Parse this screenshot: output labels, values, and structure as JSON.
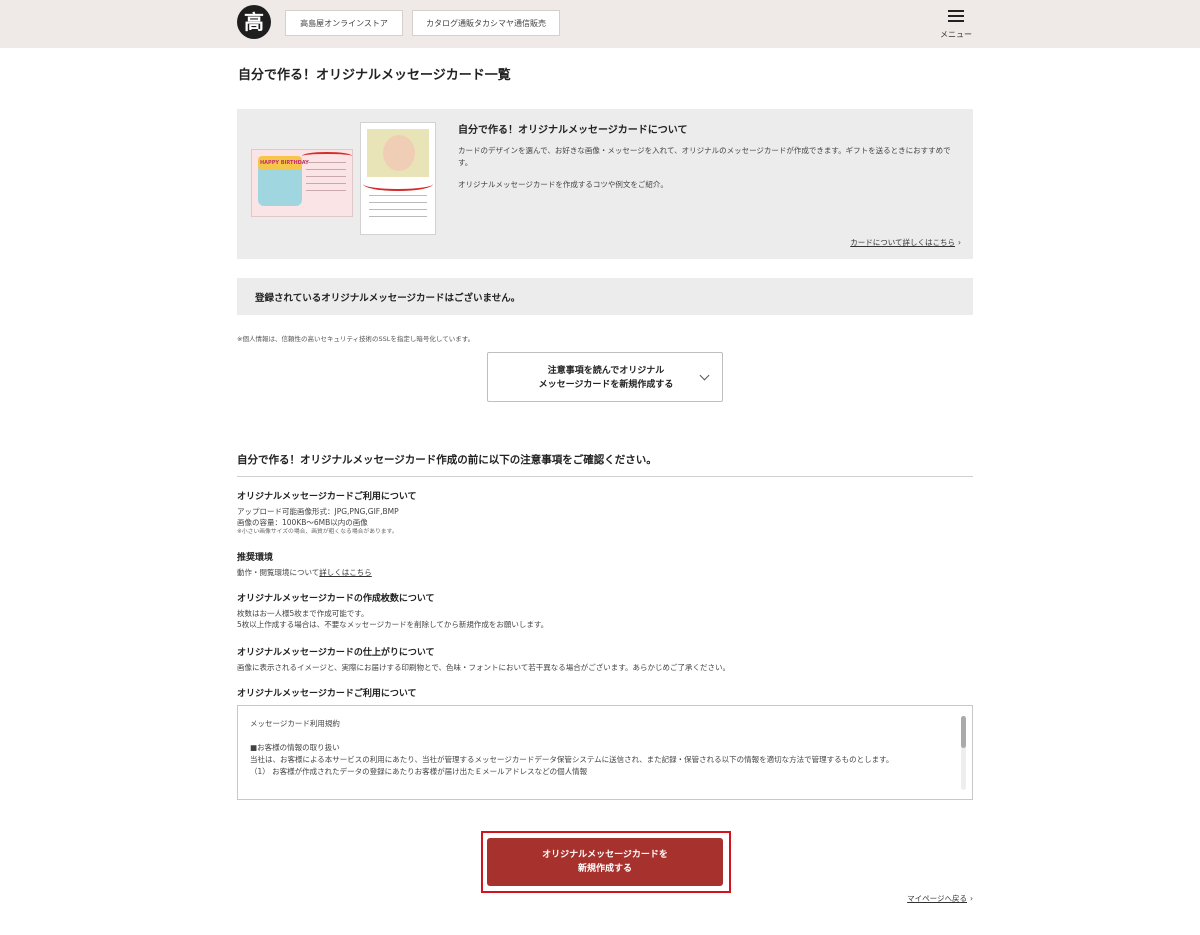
{
  "header": {
    "logo_char": "高",
    "links": [
      "高島屋オンラインストア",
      "カタログ通販タカシマヤ通信販売"
    ],
    "menu_label": "メニュー"
  },
  "page_title": "自分で作る！オリジナルメッセージカード一覧",
  "intro": {
    "title": "自分で作る！オリジナルメッセージカードについて",
    "text1": "カードのデザインを選んで、お好きな画像・メッセージを入れて、オリジナルのメッセージカードが作成できます。ギフトを送るときにおすすめです。",
    "text2": "オリジナルメッセージカードを作成するコツや例文をご紹介。",
    "link": "カードについて詳しくはこちら",
    "card1_text": "HAPPY BIRTHDAY"
  },
  "no_cards": "登録されているオリジナルメッセージカードはございません。",
  "ssl_note": "※個人情報は、信頼性の高いセキュリティ技術のSSLを指定し暗号化しています。",
  "accordion": {
    "line1": "注意事項を読んでオリジナル",
    "line2": "メッセージカードを新規作成する"
  },
  "notice_title": "自分で作る！オリジナルメッセージカード作成の前に以下の注意事項をご確認ください。",
  "sections": {
    "usage": {
      "heading": "オリジナルメッセージカードご利用について",
      "line1": "アップロード可能画像形式：JPG,PNG,GIF,BMP",
      "line2": "画像の容量：100KB～6MB以内の画像",
      "note": "※小さい画像サイズの場合、画質が粗くなる場合があります。"
    },
    "env": {
      "heading": "推奨環境",
      "text": "動作・閲覧環境について",
      "link": "詳しくはこちら"
    },
    "count": {
      "heading": "オリジナルメッセージカードの作成枚数について",
      "line1": "枚数はお一人様5枚まで作成可能です。",
      "line2": "5枚以上作成する場合は、不要なメッセージカードを削除してから新規作成をお願いします。"
    },
    "finish": {
      "heading": "オリジナルメッセージカードの仕上がりについて",
      "line1": "画像に表示されるイメージと、実際にお届けする印刷物とで、色味・フォントにおいて若干異なる場合がございます。あらかじめご了承ください。"
    },
    "terms_heading": "オリジナルメッセージカードご利用について"
  },
  "terms": {
    "title": "メッセージカード利用規約",
    "line1": "■お客様の情報の取り扱い",
    "line2": "当社は、お客様による本サービスの利用にあたり、当社が管理するメッセージカードデータ保管システムに送信され、また記録・保管される以下の情報を適切な方法で管理するものとします。",
    "line3": "（1） お客様が作成されたデータの登録にあたりお客様が届け出たＥメールアドレスなどの個人情報"
  },
  "cta": {
    "line1": "オリジナルメッセージカードを",
    "line2": "新規作成する"
  },
  "mypage_link": "マイページへ戻る"
}
